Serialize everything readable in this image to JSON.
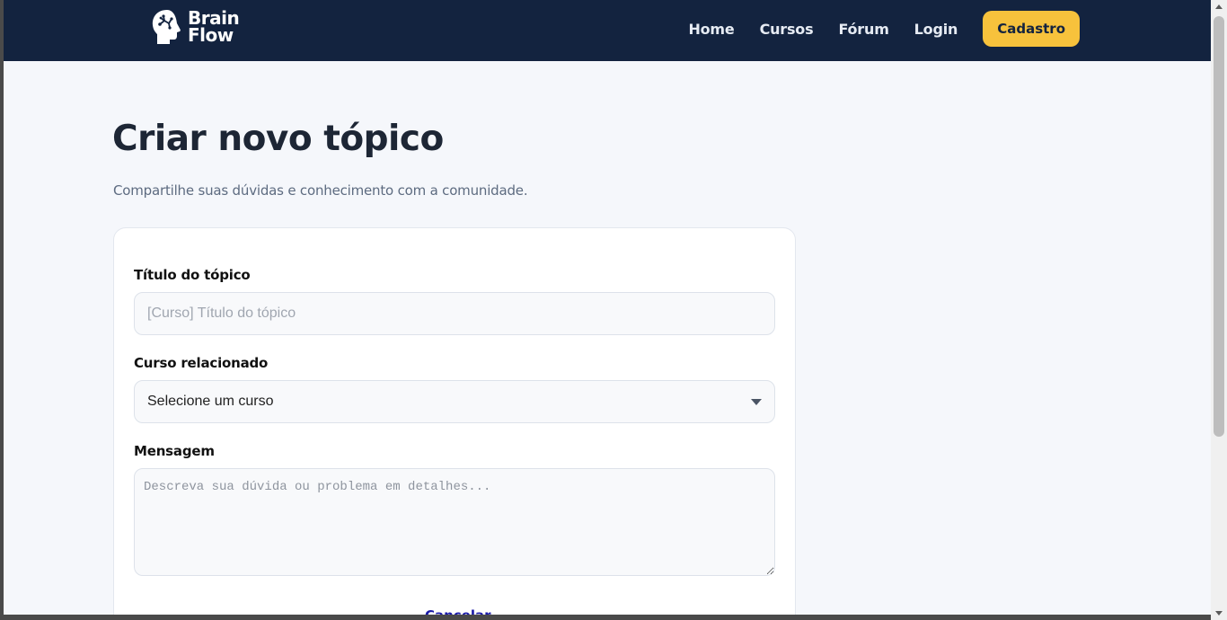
{
  "navbar": {
    "logo_line1": "Brain",
    "logo_line2": "Flow",
    "links": [
      "Home",
      "Cursos",
      "Fórum",
      "Login"
    ],
    "signup_label": "Cadastro"
  },
  "page": {
    "title": "Criar novo tópico",
    "subtitle": "Compartilhe suas dúvidas e conhecimento com a comunidade."
  },
  "form": {
    "title_label": "Título do tópico",
    "title_placeholder": "[Curso] Título do tópico",
    "title_value": "",
    "course_label": "Curso relacionado",
    "course_selected": "Selecione um curso",
    "message_label": "Mensagem",
    "message_placeholder": "Descreva sua dúvida ou problema em detalhes...",
    "message_value": "",
    "cancel_label": "Cancelar"
  },
  "colors": {
    "navbar_bg": "#13233f",
    "accent": "#f7c23c",
    "page_bg": "#f5f7fb",
    "link": "#1a1aa8"
  },
  "icons": {
    "logo": "brain-head-icon",
    "select": "chevron-down-icon"
  }
}
